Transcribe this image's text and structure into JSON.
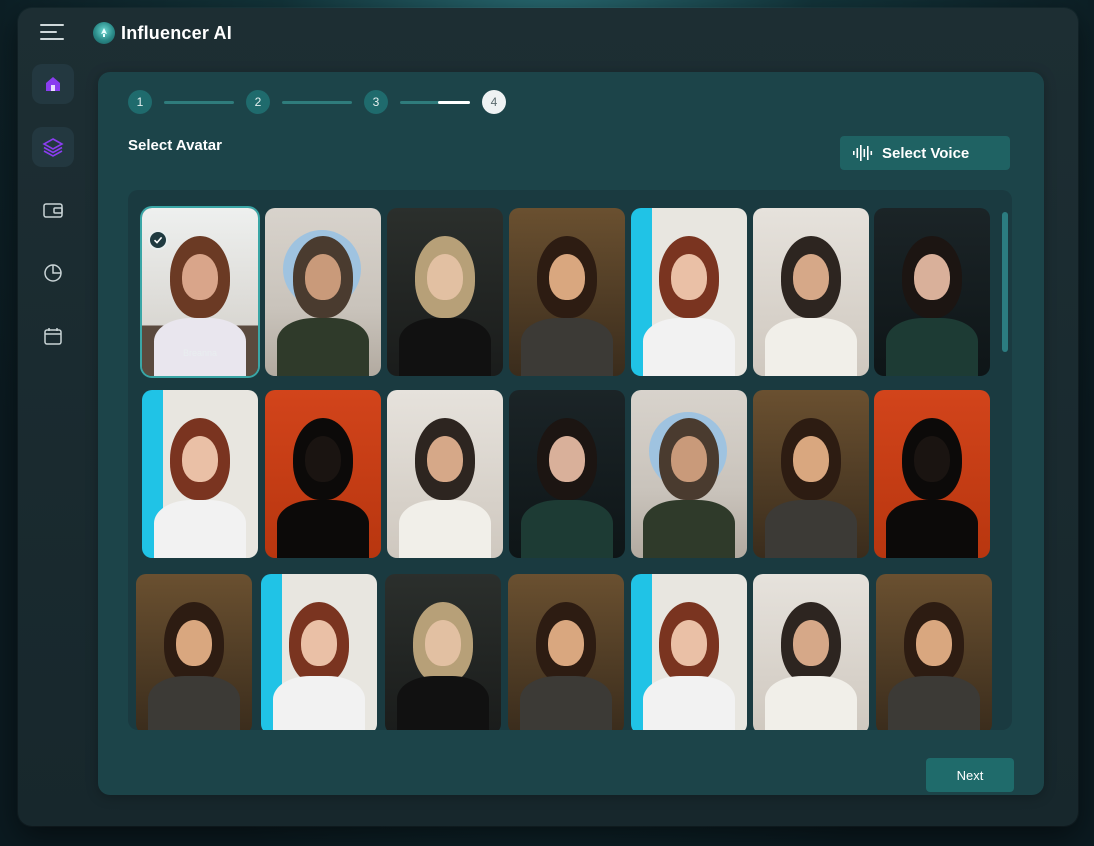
{
  "app": {
    "title": "Influencer AI"
  },
  "sidebar": {
    "items": [
      {
        "icon": "home-icon",
        "active": true
      },
      {
        "icon": "layers-icon",
        "active": true
      },
      {
        "icon": "wallet-icon",
        "active": false
      },
      {
        "icon": "pie-chart-icon",
        "active": false
      },
      {
        "icon": "calendar-icon",
        "active": false
      }
    ]
  },
  "stepper": {
    "steps": [
      "1",
      "2",
      "3",
      "4"
    ],
    "current": "4"
  },
  "main": {
    "section_title": "Select Avatar",
    "voice_button_label": "Select Voice",
    "next_button_label": "Next"
  },
  "avatars": {
    "selected_label": "Breanna",
    "items": [
      {
        "kind": "yoga-woman",
        "selected": true
      },
      {
        "kind": "man-round-window"
      },
      {
        "kind": "woman-dark-blonde"
      },
      {
        "kind": "woman-glasses"
      },
      {
        "kind": "woman-red-hair-blue"
      },
      {
        "kind": "man-glasses-tiles"
      },
      {
        "kind": "woman-dark-beret"
      },
      {
        "kind": "woman-red-hair-blue"
      },
      {
        "kind": "man-silhouette-orange"
      },
      {
        "kind": "man-glasses-tiles"
      },
      {
        "kind": "woman-dark-beret"
      },
      {
        "kind": "man-round-window"
      },
      {
        "kind": "woman-glasses"
      },
      {
        "kind": "man-silhouette-orange"
      },
      {
        "kind": "woman-glasses"
      },
      {
        "kind": "woman-red-hair-blue"
      },
      {
        "kind": "woman-dark-blonde"
      },
      {
        "kind": "woman-glasses"
      },
      {
        "kind": "woman-red-hair-blue"
      },
      {
        "kind": "man-glasses-tiles"
      },
      {
        "kind": "woman-glasses"
      }
    ]
  },
  "colors": {
    "panel": "#1c4449",
    "accent": "#1f6b6b",
    "sidebar_active_icon": "#8a3df0"
  }
}
